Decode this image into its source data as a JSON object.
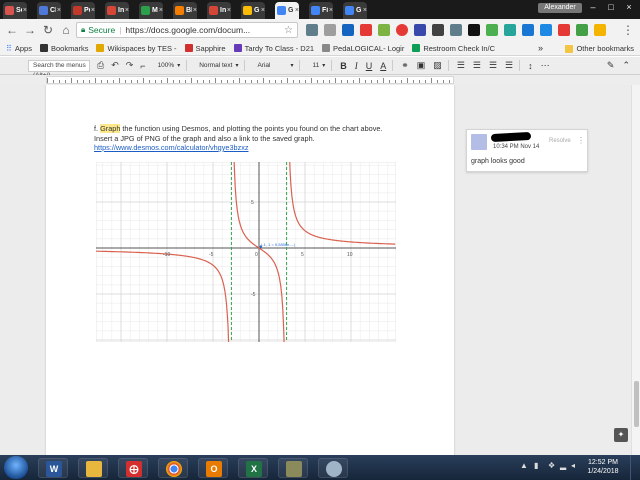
{
  "tabs": [
    {
      "label": "Sc",
      "color": "#d9534f"
    },
    {
      "label": "Cl",
      "color": "#4f79d9"
    },
    {
      "label": "Pe",
      "color": "#c0392b"
    },
    {
      "label": "In",
      "color": "#d44638"
    },
    {
      "label": "M",
      "color": "#2b9f4a"
    },
    {
      "label": "Bl",
      "color": "#f57d00"
    },
    {
      "label": "In",
      "color": "#d44638"
    },
    {
      "label": "G",
      "color": "#fbbc05"
    },
    {
      "label": "G",
      "color": "#4285f4"
    },
    {
      "label": "Fi",
      "color": "#4285f4"
    },
    {
      "label": "G",
      "color": "#4285f4"
    }
  ],
  "active_tab_index": 8,
  "tab_close_glyph": "×",
  "profile_name": "Alexander",
  "url_bar": {
    "secure_label": "Secure",
    "url": "https://docs.google.com/docum...",
    "separator": "|"
  },
  "bookmarks": {
    "apps_label": "Apps",
    "items": [
      {
        "label": "Bookmarks",
        "color": "#333333"
      },
      {
        "label": "Wikispaces by TES -",
        "color": "#e0a800"
      },
      {
        "label": "Sapphire",
        "color": "#d03030"
      },
      {
        "label": "Tardy To Class - D21",
        "color": "#673ab7"
      },
      {
        "label": "PedaLOGICAL- Logir",
        "color": "#888888"
      },
      {
        "label": "Restroom Check In/C",
        "color": "#0f9d58"
      }
    ],
    "more_glyph": "»",
    "other_label": "Other bookmarks"
  },
  "docs_toolbar": {
    "search_menus": "Search the menus (Alt+/)",
    "zoom": "100%",
    "style": "Normal text",
    "font": "Arial",
    "size": "11"
  },
  "document": {
    "para_prefix": "f.  ",
    "para_highlight": "Graph",
    "para_text": " the function using Desmos, and plotting the points you found on the chart above. Insert a JPG of PNG of the graph and also a link to the saved graph.",
    "link": "https://www.desmos.com/calculator/vhgye3bzxz"
  },
  "graph": {
    "x_ticks": [
      "-10",
      "-5",
      "0",
      "5",
      "10"
    ],
    "y_ticks": [
      "5",
      "-5"
    ],
    "point_label": "(-1, 1 = 5.5856e-...)",
    "curve_color": "#d9624f",
    "asymptote_color": "#33a04a"
  },
  "comment": {
    "time": "10:34 PM Nov 14",
    "resolve": "Resolve",
    "text": "graph looks good",
    "more": "⋮"
  },
  "taskbar": {
    "time": "12:52 PM",
    "date": "1/24/2018"
  }
}
